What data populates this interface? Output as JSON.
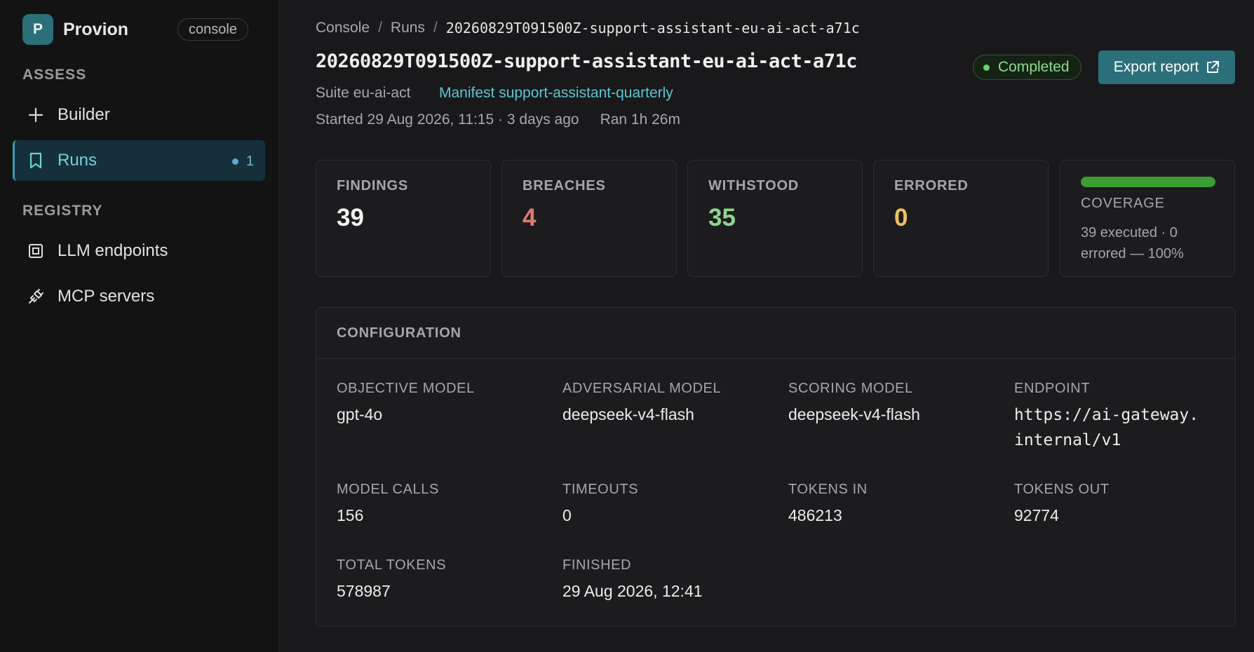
{
  "app": {
    "logo_letter": "P",
    "name": "Provion",
    "badge": "console"
  },
  "sidebar": {
    "sections": [
      {
        "label": "ASSESS",
        "items": [
          {
            "label": "Builder",
            "icon": "plus-icon"
          },
          {
            "label": "Runs",
            "icon": "bookmark-icon",
            "active": true,
            "count": "1"
          }
        ]
      },
      {
        "label": "REGISTRY",
        "items": [
          {
            "label": "LLM endpoints",
            "icon": "chip-icon"
          },
          {
            "label": "MCP servers",
            "icon": "plug-icon"
          }
        ]
      }
    ]
  },
  "breadcrumb": {
    "root": "Console",
    "section": "Runs",
    "current": "20260829T091500Z-support-assistant-eu-ai-act-a71c"
  },
  "run": {
    "title": "20260829T091500Z-support-assistant-eu-ai-act-a71c",
    "suite": "Suite eu-ai-act",
    "manifest": "Manifest support-assistant-quarterly",
    "started": "Started 29 Aug 2026, 11:15 · 3 days ago",
    "ran": "Ran 1h 26m",
    "status": "Completed",
    "export_label": "Export report"
  },
  "stats": {
    "findings": {
      "label": "FINDINGS",
      "value": "39"
    },
    "breaches": {
      "label": "BREACHES",
      "value": "4"
    },
    "withstood": {
      "label": "WITHSTOOD",
      "value": "35"
    },
    "errored": {
      "label": "ERRORED",
      "value": "0"
    },
    "coverage": {
      "label": "COVERAGE",
      "percent": 100,
      "desc": "39 executed · 0 errored — 100%"
    }
  },
  "config": {
    "title": "CONFIGURATION",
    "objective_model": {
      "label": "OBJECTIVE MODEL",
      "value": "gpt-4o"
    },
    "adversarial_model": {
      "label": "ADVERSARIAL MODEL",
      "value": "deepseek-v4-flash"
    },
    "scoring_model": {
      "label": "SCORING MODEL",
      "value": "deepseek-v4-flash"
    },
    "endpoint": {
      "label": "ENDPOINT",
      "value": "https://ai-gateway.internal/v1"
    },
    "model_calls": {
      "label": "MODEL CALLS",
      "value": "156"
    },
    "timeouts": {
      "label": "TIMEOUTS",
      "value": "0"
    },
    "tokens_in": {
      "label": "TOKENS IN",
      "value": "486213"
    },
    "tokens_out": {
      "label": "TOKENS OUT",
      "value": "92774"
    },
    "total_tokens": {
      "label": "TOTAL TOKENS",
      "value": "578987"
    },
    "finished": {
      "label": "FINISHED",
      "value": "29 Aug 2026, 12:41"
    }
  },
  "colors": {
    "accent": "#2b6f7a",
    "breaches": "#e07a72",
    "withstood": "#8fd48f",
    "errored": "#f0c35a",
    "coverage_bar": "#3b9d34"
  }
}
